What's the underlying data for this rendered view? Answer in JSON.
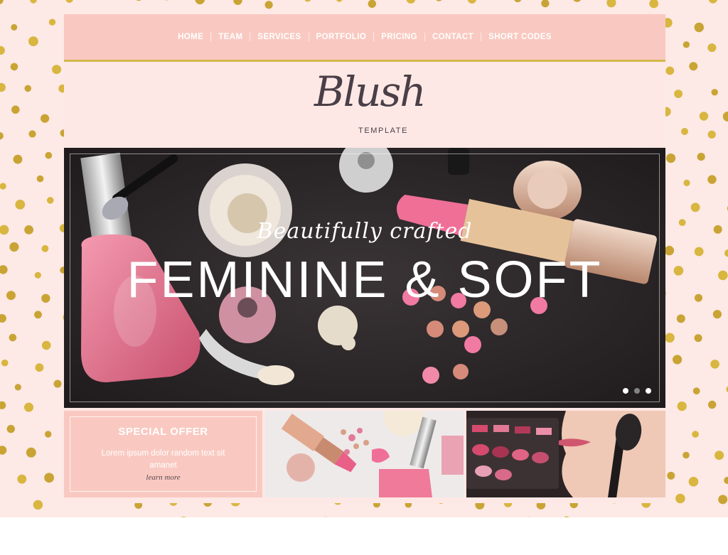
{
  "nav": {
    "items": [
      {
        "label": "HOME"
      },
      {
        "label": "TEAM"
      },
      {
        "label": "SERVICES"
      },
      {
        "label": "PORTFOLIO"
      },
      {
        "label": "PRICING"
      },
      {
        "label": "CONTACT"
      },
      {
        "label": "SHORT CODES"
      }
    ]
  },
  "logo": {
    "script": "Blush",
    "sub": "TEMPLATE"
  },
  "hero": {
    "subtitle": "Beautifully crafted",
    "title": "FEMININE & SOFT",
    "slides_total": 3,
    "slide_active": 1
  },
  "offer": {
    "title": "SPECIAL OFFER",
    "text": "Lorem ipsum dolor random text sit amanet",
    "link": "learn more"
  },
  "colors": {
    "background": "#fde9e6",
    "nav": "#f9c9c1",
    "gold": "#d4b64a",
    "logo": "#4a3f47"
  }
}
